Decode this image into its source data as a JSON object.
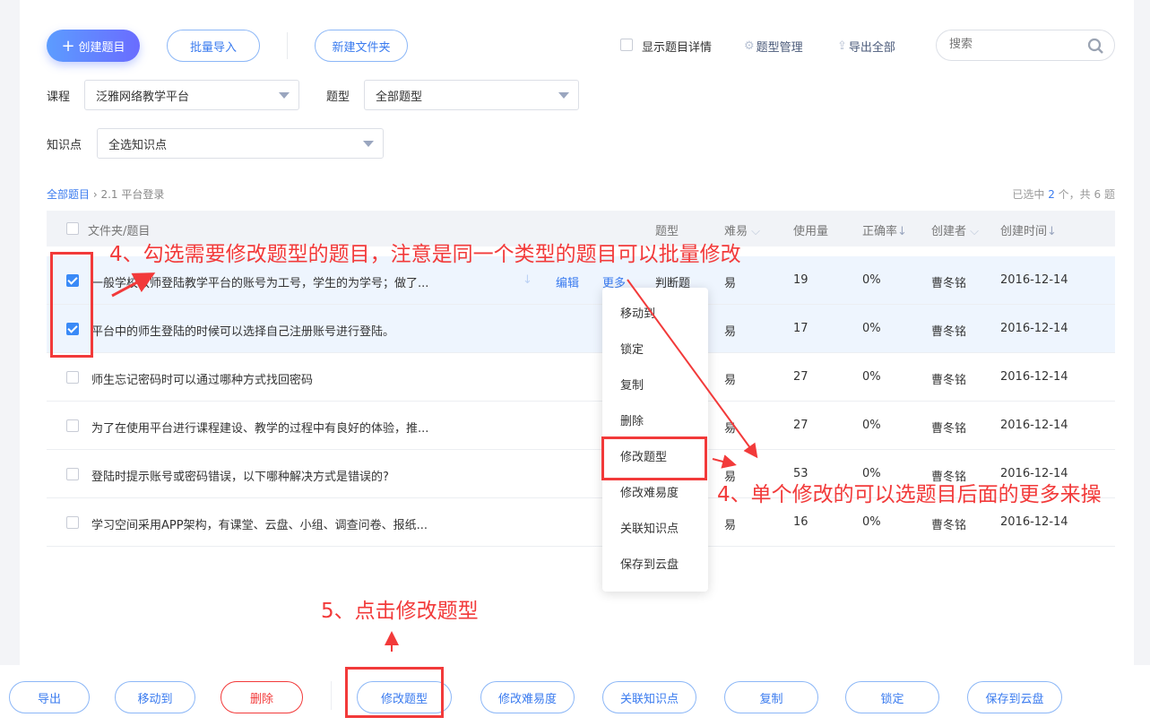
{
  "toolbar": {
    "create": "创建题目",
    "batch_import": "批量导入",
    "new_folder": "新建文件夹",
    "show_details": "显示题目详情",
    "type_manage": "题型管理",
    "export_all": "导出全部",
    "search_placeholder": "搜索"
  },
  "filters": {
    "course_label": "课程",
    "course_value": "泛雅网络教学平台",
    "type_label": "题型",
    "type_value": "全部题型",
    "knowledge_label": "知识点",
    "knowledge_value": "全选知识点"
  },
  "breadcrumb": {
    "root": "全部题目",
    "current": "2.1 平台登录"
  },
  "summary": {
    "prefix": "已选中",
    "selected": "2",
    "mid": "个，共",
    "total": "6",
    "suffix": "题"
  },
  "table": {
    "headers": {
      "title": "文件夹/题目",
      "type": "题型",
      "difficulty": "难易",
      "usage": "使用量",
      "accuracy": "正确率",
      "creator": "创建者",
      "created": "创建时间"
    },
    "edit": "编辑",
    "more": "更多",
    "rows": [
      {
        "title": "一般学校教师登陆教学平台的账号为工号，学生的为学号；做了...",
        "type": "判断题",
        "difficulty": "易",
        "usage": "19",
        "accuracy": "0%",
        "creator": "曹冬铭",
        "created": "2016-12-14",
        "checked": true
      },
      {
        "title": "平台中的师生登陆的时候可以选择自己注册账号进行登陆。",
        "type": "",
        "difficulty": "易",
        "usage": "17",
        "accuracy": "0%",
        "creator": "曹冬铭",
        "created": "2016-12-14",
        "checked": true
      },
      {
        "title": "师生忘记密码时可以通过哪种方式找回密码",
        "type": "",
        "difficulty": "易",
        "usage": "27",
        "accuracy": "0%",
        "creator": "曹冬铭",
        "created": "2016-12-14",
        "checked": false
      },
      {
        "title": "为了在使用平台进行课程建设、教学的过程中有良好的体验，推...",
        "type": "",
        "difficulty": "易",
        "usage": "27",
        "accuracy": "0%",
        "creator": "曹冬铭",
        "created": "2016-12-14",
        "checked": false
      },
      {
        "title": "登陆时提示账号或密码错误，以下哪种解决方式是错误的?",
        "type": "",
        "difficulty": "易",
        "usage": "53",
        "accuracy": "0%",
        "creator": "曹冬铭",
        "created": "2016-12-14",
        "checked": false
      },
      {
        "title": "学习空间采用APP架构，有课堂、云盘、小组、调查问卷、报纸...",
        "type": "",
        "difficulty": "易",
        "usage": "16",
        "accuracy": "0%",
        "creator": "曹冬铭",
        "created": "2016-12-14",
        "checked": false
      }
    ]
  },
  "more_menu": [
    "移动到",
    "锁定",
    "复制",
    "删除",
    "修改题型",
    "修改难易度",
    "关联知识点",
    "保存到云盘"
  ],
  "bottom_bar": [
    "导出",
    "移动到",
    "删除",
    "修改题型",
    "修改难易度",
    "关联知识点",
    "复制",
    "锁定",
    "保存到云盘"
  ],
  "annotations": {
    "a1": "4、勾选需要修改题型的题目，注意是同一个类型的题目可以批量修改",
    "a2": "4、单个修改的可以选题目后面的更多来操",
    "a3": "5、点击修改题型"
  },
  "colors": {
    "accent": "#3a7bef",
    "annotation": "#f23a3a"
  }
}
